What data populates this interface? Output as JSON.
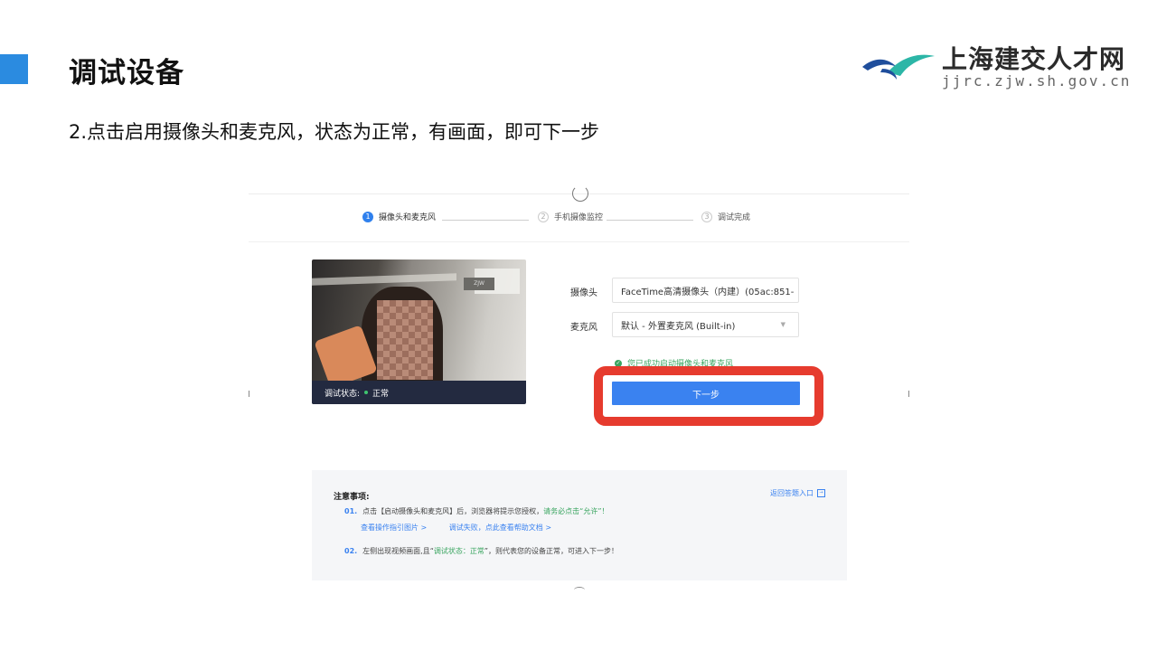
{
  "slide": {
    "title": "调试设备",
    "instruction": "2.点击启用摄像头和麦克风，状态为正常，有画面，即可下一步",
    "accent_color": "#2b8be0",
    "highlight_color": "#e63b2e"
  },
  "logo": {
    "name": "上海建交人才网",
    "url": "jjrc.zjw.sh.gov.cn",
    "icon": "bird-logo-icon"
  },
  "screenshot": {
    "steps": [
      {
        "num": "1",
        "label": "摄像头和麦克风",
        "active": true
      },
      {
        "num": "2",
        "label": "手机摄像监控",
        "active": false
      },
      {
        "num": "3",
        "label": "调试完成",
        "active": false
      }
    ],
    "video": {
      "status_label": "调试状态:",
      "status_value": "正常",
      "sign_text": "ZJW"
    },
    "form": {
      "camera_label": "摄像头",
      "camera_value": "FaceTime高清摄像头（内建）(05ac:851-",
      "mic_label": "麦克风",
      "mic_value": "默认 - 外置麦克风 (Built-in)",
      "success_message": "您已成功启动摄像头和麦克风",
      "next_button": "下一步"
    },
    "notice": {
      "title": "注意事项:",
      "back_link": "返回答题入口",
      "item1_num": "01.",
      "item1_text_a": "点击【启动摄像头和麦克风】后，浏览器将提示您授权，",
      "item1_text_b": "请务必点击“允许”！",
      "link_guide": "查看操作指引图片 >",
      "link_help": "调试失败，点此查看帮助文档 >",
      "item2_num": "02.",
      "item2_text_a": "左侧出现视频画面,且“",
      "item2_text_b": "调试状态：正常",
      "item2_text_c": "”，则代表您的设备正常，可进入下一步！"
    }
  }
}
